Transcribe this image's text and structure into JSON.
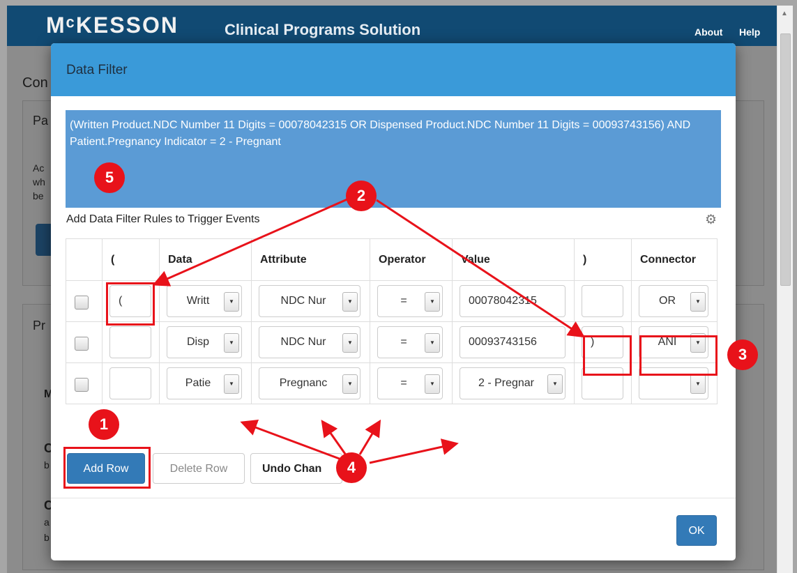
{
  "app": {
    "logo": "MᶜKESSON",
    "title": "Clinical Programs Solution",
    "about": "About",
    "help": "Help"
  },
  "background": {
    "page_heading": "Con",
    "panel1_label": "Pa",
    "panel1_text": [
      "Ac",
      "wh",
      "be"
    ],
    "panel2_label": "Pr",
    "row_letters": [
      "M",
      "C",
      "b",
      "C",
      "a",
      "b"
    ]
  },
  "modal": {
    "title": "Data Filter",
    "expression": "(Written Product.NDC Number 11 Digits = 00078042315 OR Dispensed Product.NDC Number 11 Digits = 00093743156) AND Patient.Pregnancy Indicator = 2 - Pregnant",
    "subtitle": "Add Data Filter Rules to Trigger Events",
    "gear_icon": "gear-icon",
    "columns": [
      "(",
      "Data",
      "Attribute",
      "Operator",
      "Value",
      ")",
      "Connector"
    ],
    "rows": [
      {
        "open": "(",
        "data": "Writt",
        "attribute": "NDC Nur",
        "operator": "=",
        "value": "00078042315",
        "close": "",
        "connector": "OR"
      },
      {
        "open": "",
        "data": "Disp",
        "attribute": "NDC Nur",
        "operator": "=",
        "value": "00093743156",
        "close": ")",
        "connector": "ANI"
      },
      {
        "open": "",
        "data": "Patie",
        "attribute": "Pregnanc",
        "operator": "=",
        "value": "2 - Pregnar",
        "close": "",
        "connector": ""
      }
    ],
    "buttons": {
      "add_row": "Add Row",
      "delete_row": "Delete Row",
      "undo_changes": "Undo Chan",
      "ok": "OK"
    }
  },
  "annotations": {
    "badges": [
      "1",
      "2",
      "3",
      "4",
      "5"
    ],
    "color": "#e8121a"
  }
}
